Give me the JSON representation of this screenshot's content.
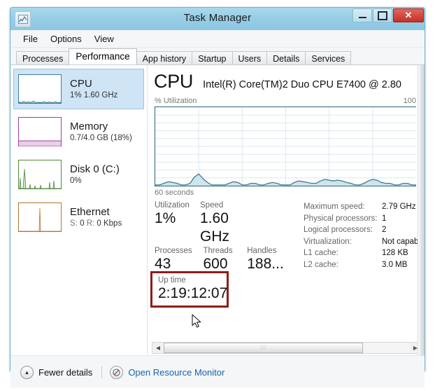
{
  "window": {
    "title": "Task Manager",
    "icon": "task-manager-icon",
    "buttons": {
      "minimize": "minimize-icon",
      "maximize": "maximize-icon",
      "close": "✕"
    }
  },
  "menu": {
    "items": [
      "File",
      "Options",
      "View"
    ]
  },
  "tabs": [
    {
      "label": "Processes",
      "active": false
    },
    {
      "label": "Performance",
      "active": true
    },
    {
      "label": "App history",
      "active": false
    },
    {
      "label": "Startup",
      "active": false
    },
    {
      "label": "Users",
      "active": false
    },
    {
      "label": "Details",
      "active": false
    },
    {
      "label": "Services",
      "active": false
    }
  ],
  "sidebar": {
    "items": [
      {
        "name": "CPU",
        "title": "CPU",
        "sub": "1%  1.60 GHz",
        "selected": true,
        "color": "#4a89a8"
      },
      {
        "name": "Memory",
        "title": "Memory",
        "sub": "0.7/4.0 GB (18%)",
        "selected": false,
        "color": "#a23fa2"
      },
      {
        "name": "Disk 0 (C:)",
        "title": "Disk 0 (C:)",
        "sub": "0%",
        "selected": false,
        "color": "#4f8a3c"
      },
      {
        "name": "Ethernet",
        "title": "Ethernet",
        "sub_prefix_s": "S:",
        "sub_s_val": "0",
        "sub_prefix_r": "R:",
        "sub_r_val": "0 Kbps",
        "sub": "S: 0 R: 0 Kbps",
        "selected": false,
        "color": "#b5762a"
      }
    ]
  },
  "main": {
    "heading": "CPU",
    "cpu_name": "Intel(R) Core(TM)2 Duo CPU E7400 @ 2.80",
    "graph": {
      "y_label": "% Utilization",
      "y_max": "100",
      "x_label": "60 seconds",
      "line_color": "#3a7d96",
      "fill_color": "#cfe4ec"
    },
    "stats_left": [
      {
        "label": "Utilization",
        "value": "1%"
      },
      {
        "label": "Speed",
        "value": "1.60 GHz"
      },
      {
        "label": "Processes",
        "value": "43"
      },
      {
        "label": "Threads",
        "value": "600"
      },
      {
        "label": "Handles",
        "value": "188..."
      }
    ],
    "stats_right": [
      {
        "label": "Maximum speed:",
        "value": "2.79 GHz"
      },
      {
        "label": "Physical processors:",
        "value": "1"
      },
      {
        "label": "Logical processors:",
        "value": "2"
      },
      {
        "label": "Virtualization:",
        "value": "Not capabl"
      },
      {
        "label": "L1 cache:",
        "value": "128 KB"
      },
      {
        "label": "L2 cache:",
        "value": "3.0 MB"
      }
    ],
    "uptime": {
      "label": "Up time",
      "value": "2:19:12:07",
      "highlight_color": "#8c1f18"
    },
    "scrollbar": {
      "left_arrow": "◀",
      "right_arrow": "▶",
      "grip": "⦙⦙⦙"
    }
  },
  "statusbar": {
    "fewer_details": "Fewer details",
    "fewer_details_icon": "chevron-up-icon",
    "resource_monitor": "Open Resource Monitor",
    "resource_monitor_icon": "resource-monitor-icon",
    "link_color": "#1764b0"
  },
  "chart_data": {
    "type": "area",
    "title": "CPU % Utilization",
    "xlabel": "60 seconds",
    "ylabel": "% Utilization",
    "ylim": [
      0,
      100
    ],
    "grid": true,
    "series": [
      {
        "name": "CPU Utilization",
        "values": [
          1,
          1,
          2,
          4,
          3,
          2,
          1,
          1,
          2,
          10,
          14,
          8,
          3,
          1,
          1,
          1,
          1,
          2,
          4,
          3,
          1,
          1,
          2,
          2,
          1,
          1,
          2,
          3,
          2,
          1,
          1,
          1,
          3,
          5,
          4,
          3,
          2,
          2,
          5,
          7,
          6,
          5,
          6,
          5,
          3,
          2,
          1,
          1,
          2,
          5,
          7,
          6,
          3,
          2,
          2,
          1,
          1,
          2,
          2,
          1
        ]
      }
    ]
  }
}
